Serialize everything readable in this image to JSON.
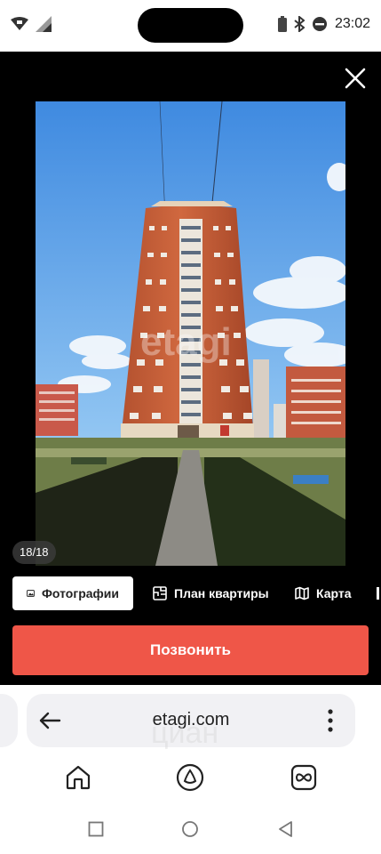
{
  "status_bar": {
    "time": "23:02"
  },
  "viewer": {
    "counter": "18/18",
    "watermark": "etagi",
    "tabs": [
      {
        "label": "Фотографии",
        "icon": "image-icon",
        "active": true
      },
      {
        "label": "План квартиры",
        "icon": "floorplan-icon",
        "active": false
      },
      {
        "label": "Карта",
        "icon": "map-icon",
        "active": false
      }
    ],
    "call_button": "Позвонить"
  },
  "browser": {
    "url": "etagi.com",
    "watermark": "циан"
  },
  "colors": {
    "accent": "#ef5648",
    "viewer_bg": "#000000",
    "url_bar_bg": "#f1f1f4"
  }
}
